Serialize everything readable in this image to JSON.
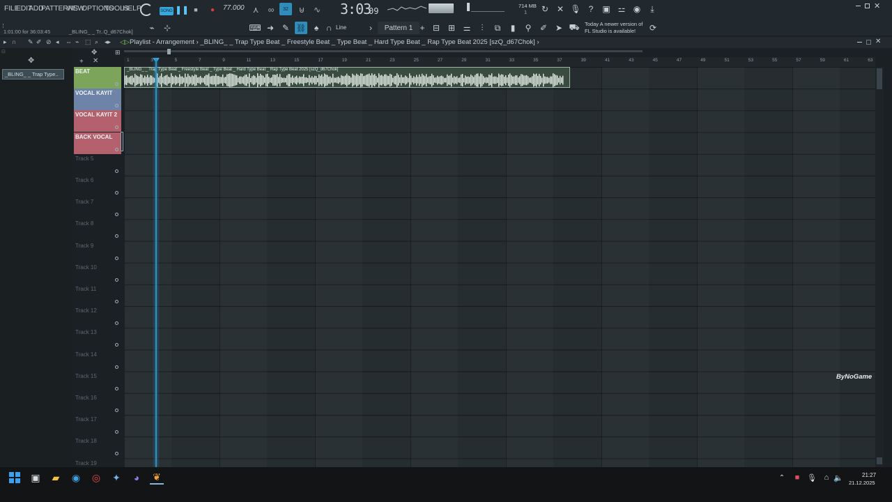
{
  "menu": [
    "FILE",
    "EDIT",
    "ADD",
    "PATTERNS",
    "VIEW",
    "OPTIONS",
    "TOOLS",
    "HELP"
  ],
  "transport": {
    "tempo": "77.000",
    "song_time": "3:03",
    "song_time_sub": "09",
    "mode_label": "SONG"
  },
  "hint_line": "1:01:00 for 36:03:45",
  "project_short": "_BLING_ _ Tr..Q_d67Chok]",
  "memory": "714 MB",
  "memory_sub": "1",
  "snap_label": "Line",
  "pattern_label": "Pattern 1",
  "news": {
    "line1": "Today  A newer version of",
    "line2": "FL Studio is available!"
  },
  "playlist": {
    "title": "Playlist - Arrangement",
    "breadcrumb_sep": "›",
    "project_name": "_BLING_ _ Trap Type Beat _ Freestyle Beat _ Type Beat _ Hard Type Beat _ Rap Type Beat 2025 [szQ_d67Chok]"
  },
  "picker_item": "_BLING_ _ Trap Type..",
  "ruler": [
    "1",
    "3",
    "5",
    "7",
    "9",
    "11",
    "13",
    "15",
    "17",
    "19",
    "21",
    "23",
    "25",
    "27",
    "29",
    "31",
    "33",
    "35",
    "37",
    "39",
    "41",
    "43",
    "45",
    "47",
    "49",
    "51",
    "53",
    "55",
    "57",
    "59",
    "61",
    "63"
  ],
  "tracks": [
    {
      "name": "BEAT",
      "color": "#7ca45a"
    },
    {
      "name": "VOCAL KAYIT",
      "color": "#6d84a8"
    },
    {
      "name": "VOCAL KAYIT 2",
      "color": "#b5606d"
    },
    {
      "name": "BACK VOCAL",
      "color": "#b5606d"
    },
    {
      "name": "Track 5"
    },
    {
      "name": "Track 6"
    },
    {
      "name": "Track 7"
    },
    {
      "name": "Track 8"
    },
    {
      "name": "Track 9"
    },
    {
      "name": "Track 10"
    },
    {
      "name": "Track 11"
    },
    {
      "name": "Track 12"
    },
    {
      "name": "Track 13"
    },
    {
      "name": "Track 14"
    },
    {
      "name": "Track 15"
    },
    {
      "name": "Track 16"
    },
    {
      "name": "Track 17"
    },
    {
      "name": "Track 18"
    },
    {
      "name": "Track 19"
    }
  ],
  "clip_label": "_BLING_ _ Trap Type Beat _ Freestyle Beat _ Type Beat _ Hard Type Beat _ Rap Type Beat 2025 [szQ_d67Chok]",
  "watermark": "ByNoGame",
  "taskbar": {
    "time": "21:27",
    "date": "21.12.2025"
  },
  "colors": {
    "accent": "#2c8fc4",
    "clip": "#3a4c42",
    "record": "#e23b3b"
  }
}
